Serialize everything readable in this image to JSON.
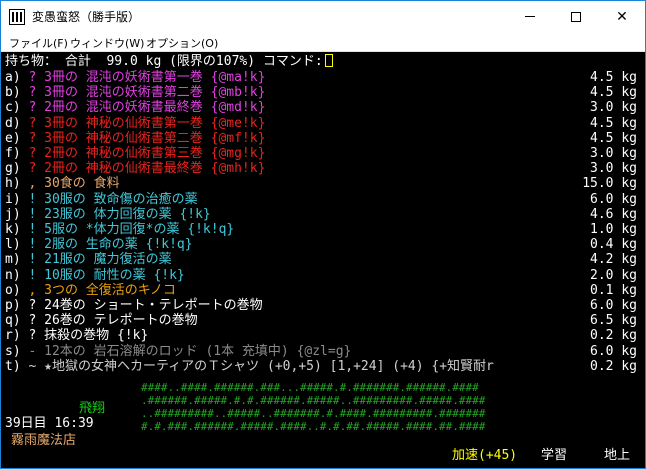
{
  "window": {
    "title": "変愚蛮怒（勝手版）",
    "menu": [
      "ファイル(F)",
      "ウィンドウ(W)",
      "オプション(O)"
    ]
  },
  "header": {
    "text": "持ち物： 合計  99.0 kg (限界の107%) コマンド:"
  },
  "items": [
    {
      "slot": "a)",
      "text": "? 3冊の 混沌の妖術書第一巻 {@ma!k}",
      "weight": "4.5 kg",
      "color": "#e040e0"
    },
    {
      "slot": "b)",
      "text": "? 3冊の 混沌の妖術書第二巻 {@mb!k}",
      "weight": "4.5 kg",
      "color": "#e040e0"
    },
    {
      "slot": "c)",
      "text": "? 2冊の 混沌の妖術書最終巻 {@md!k}",
      "weight": "3.0 kg",
      "color": "#e040e0"
    },
    {
      "slot": "d)",
      "text": "? 3冊の 神秘の仙術書第一巻 {@me!k}",
      "weight": "4.5 kg",
      "color": "#e8231e"
    },
    {
      "slot": "e)",
      "text": "? 3冊の 神秘の仙術書第二巻 {@mf!k}",
      "weight": "4.5 kg",
      "color": "#e8231e"
    },
    {
      "slot": "f)",
      "text": "? 2冊の 神秘の仙術書第三巻 {@mg!k}",
      "weight": "3.0 kg",
      "color": "#e8231e"
    },
    {
      "slot": "g)",
      "text": "? 2冊の 神秘の仙術書最終巻 {@mh!k}",
      "weight": "3.0 kg",
      "color": "#e8231e"
    },
    {
      "slot": "h)",
      "text": ", 30食の 食料",
      "weight": "15.0 kg",
      "color": "#e8a86a"
    },
    {
      "slot": "i)",
      "text": "! 30服の 致命傷の治癒の薬",
      "weight": "6.0 kg",
      "color": "#40c8d8"
    },
    {
      "slot": "j)",
      "text": "! 23服の 体力回復の薬 {!k}",
      "weight": "4.6 kg",
      "color": "#40c8d8"
    },
    {
      "slot": "k)",
      "text": "! 5服の *体力回復*の薬 {!k!q}",
      "weight": "1.0 kg",
      "color": "#40c8d8"
    },
    {
      "slot": "l)",
      "text": "! 2服の 生命の薬 {!k!q}",
      "weight": "0.4 kg",
      "color": "#40c8d8"
    },
    {
      "slot": "m)",
      "text": "! 21服の 魔力復活の薬",
      "weight": "4.2 kg",
      "color": "#40c8d8"
    },
    {
      "slot": "n)",
      "text": "! 10服の 耐性の薬 {!k}",
      "weight": "2.0 kg",
      "color": "#40c8d8"
    },
    {
      "slot": "o)",
      "text": ", 3つの 全復活のキノコ",
      "weight": "0.1 kg",
      "color": "#e8a010"
    },
    {
      "slot": "p)",
      "text": "? 24巻の ショート・テレポートの巻物",
      "weight": "6.0 kg",
      "color": "#ffffff"
    },
    {
      "slot": "q)",
      "text": "? 26巻の テレポートの巻物",
      "weight": "6.5 kg",
      "color": "#ffffff"
    },
    {
      "slot": "r)",
      "text": "? 抹殺の巻物 {!k}",
      "weight": "0.2 kg",
      "color": "#ffffff"
    },
    {
      "slot": "s)",
      "text": "- 12本の 岩石溶解のロッド (1本 充填中) {@zl=g}",
      "weight": "6.0 kg",
      "color": "#8a8a8a"
    },
    {
      "slot": "t)",
      "text": "~ ★地獄の女神ヘカーティアのＴシャツ (+0,+5) [1,+24] (+4) {+知賢耐r",
      "weight": "0.2 kg",
      "color": "#d0d0d0"
    }
  ],
  "map": {
    "lines": [
      "####..####.######.###...#####.#.#######.######.####",
      ".######.#####.#.#.######.#####..#########.#####.####",
      "..#########..#####..#######.#.####.#########.#######",
      "#.#.###.######.#####.####..#.#.##.#####.####.##.####"
    ]
  },
  "status": {
    "fly": "飛翔",
    "date": "39日目 16:39",
    "location": "霧雨魔法店",
    "speed": "加速(+45)",
    "study": "学習",
    "depth": "地上"
  }
}
